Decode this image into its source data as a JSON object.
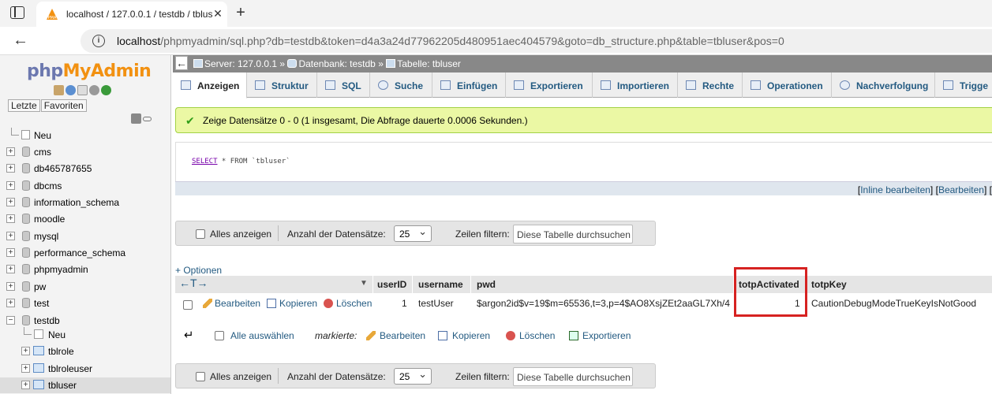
{
  "browser": {
    "tab_title": "localhost / 127.0.0.1 / testdb / tbluser",
    "tab_close": "✕",
    "new_tab": "+",
    "url_host": "localhost",
    "url_path": "/phpmyadmin/sql.php?db=testdb&token=d4a3a24d77962205d480951aec404579&goto=db_structure.php&table=tbluser&pos=0"
  },
  "nav": {
    "logo_php": "php",
    "logo_my": "My",
    "logo_admin": "Admin",
    "tab_recent": "Letzte",
    "tab_favorites": "Favoriten",
    "tree": [
      {
        "label": "Neu",
        "type": "new"
      },
      {
        "label": "cms",
        "type": "db"
      },
      {
        "label": "db465787655",
        "type": "db"
      },
      {
        "label": "dbcms",
        "type": "db"
      },
      {
        "label": "information_schema",
        "type": "db"
      },
      {
        "label": "moodle",
        "type": "db"
      },
      {
        "label": "mysql",
        "type": "db"
      },
      {
        "label": "performance_schema",
        "type": "db"
      },
      {
        "label": "phpmyadmin",
        "type": "db"
      },
      {
        "label": "pw",
        "type": "db"
      },
      {
        "label": "test",
        "type": "db"
      },
      {
        "label": "testdb",
        "type": "db-open"
      }
    ],
    "subtree": [
      {
        "label": "Neu",
        "type": "new"
      },
      {
        "label": "tblrole",
        "type": "table"
      },
      {
        "label": "tblroleuser",
        "type": "table"
      },
      {
        "label": "tbluser",
        "type": "table-selected"
      }
    ]
  },
  "breadcrumb": {
    "server": "Server: 127.0.0.1",
    "database": "Datenbank: testdb",
    "table": "Tabelle: tbluser",
    "sep": "»"
  },
  "tabs": [
    {
      "label": "Anzeigen",
      "active": true
    },
    {
      "label": "Struktur"
    },
    {
      "label": "SQL"
    },
    {
      "label": "Suche"
    },
    {
      "label": "Einfügen"
    },
    {
      "label": "Exportieren"
    },
    {
      "label": "Importieren"
    },
    {
      "label": "Rechte"
    },
    {
      "label": "Operationen"
    },
    {
      "label": "Nachverfolgung"
    },
    {
      "label": "Trigge"
    }
  ],
  "message": {
    "success": "Zeige Datensätze 0 - 0 (1 insgesamt, Die Abfrage dauerte 0.0006 Sekunden.)"
  },
  "sql": {
    "keyword": "SELECT",
    "rest": " * FROM `tbluser`",
    "bracket_open": "[",
    "inline_edit": "Inline bearbeiten",
    "mid": "] [",
    "edit": "Bearbeiten",
    "tail": "] ["
  },
  "navbar": {
    "show_all": "Alles anzeigen",
    "row_count_label": "Anzahl der Datensätze:",
    "row_count_value": "25",
    "filter_label": "Zeilen filtern:",
    "filter_placeholder": "Diese Tabelle durchsuchen"
  },
  "options_link": "+ Optionen",
  "table": {
    "col_arrows": "←T→",
    "headers": [
      "userID",
      "username",
      "pwd",
      "totpActivated",
      "totpKey"
    ],
    "row": {
      "edit": "Bearbeiten",
      "copy": "Kopieren",
      "delete": "Löschen",
      "userID": "1",
      "username": "testUser",
      "pwd": "$argon2id$v=19$m=65536,t=3,p=4$AO8XsjZEt2aaGL7Xh/4...",
      "totpActivated": "1",
      "totpKey": "CautionDebugModeTrueKeyIsNotGood"
    }
  },
  "batch": {
    "select_all": "Alle auswählen",
    "marked": "markierte:",
    "edit": "Bearbeiten",
    "copy": "Kopieren",
    "delete": "Löschen",
    "export": "Exportieren"
  },
  "colors": {
    "link": "#235a81",
    "success_bg": "#ebf8a4",
    "highlight": "#d62221"
  }
}
